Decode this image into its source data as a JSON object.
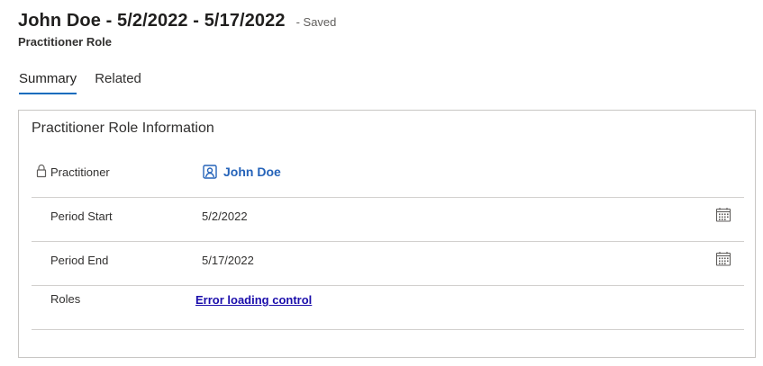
{
  "header": {
    "title": "John Doe - 5/2/2022 - 5/17/2022",
    "save_status": "- Saved",
    "entity_name": "Practitioner Role"
  },
  "tabs": [
    {
      "label": "Summary",
      "active": true
    },
    {
      "label": "Related",
      "active": false
    }
  ],
  "section": {
    "title": "Practitioner Role Information",
    "fields": {
      "practitioner": {
        "label": "Practitioner",
        "value": "John Doe",
        "locked": true,
        "icon": "contact-card-icon"
      },
      "period_start": {
        "label": "Period Start",
        "value": "5/2/2022",
        "icon": "calendar-icon"
      },
      "period_end": {
        "label": "Period End",
        "value": "5/17/2022",
        "icon": "calendar-icon"
      },
      "roles": {
        "label": "Roles",
        "value": "Error loading control"
      }
    }
  },
  "colors": {
    "tab_underline": "#0f6cbd",
    "lookup_link": "#2563b9",
    "error_link": "#1a0dab",
    "border": "#c8c6c4"
  }
}
